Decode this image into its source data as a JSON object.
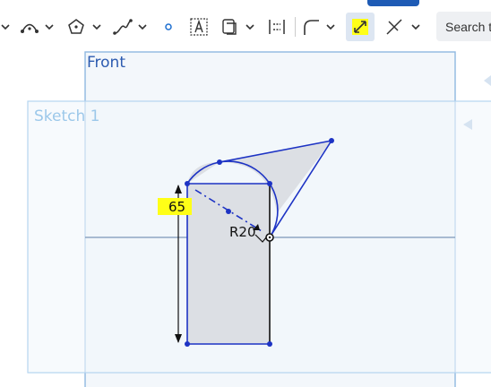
{
  "toolbar": {
    "search_label": "Search t"
  },
  "viewport": {
    "front_plane_label": "Front",
    "sketch_label": "Sketch 1",
    "dimension_value": "65",
    "radius_label": "R20"
  },
  "colors": {
    "sketch_blue": "#1d33c4",
    "plane_blue": "#7fb0dc",
    "highlight_yellow": "#ffff17",
    "accent_blue": "#1e5bb5"
  }
}
